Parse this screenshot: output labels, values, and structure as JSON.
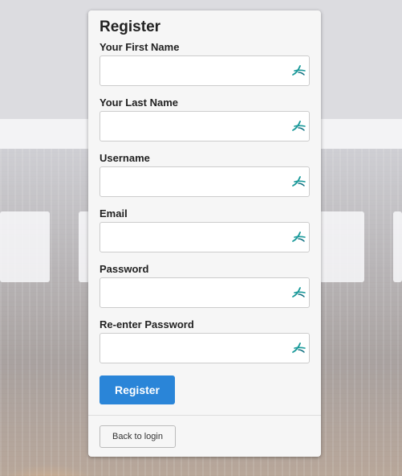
{
  "form": {
    "title": "Register",
    "fields": [
      {
        "label": "Your First Name",
        "value": "",
        "placeholder": "",
        "icon": "autofill-icon"
      },
      {
        "label": "Your Last Name",
        "value": "",
        "placeholder": "",
        "icon": "autofill-icon"
      },
      {
        "label": "Username",
        "value": "",
        "placeholder": "",
        "icon": "autofill-icon"
      },
      {
        "label": "Email",
        "value": "",
        "placeholder": "",
        "icon": "autofill-icon"
      },
      {
        "label": "Password",
        "value": "",
        "placeholder": "",
        "icon": "autofill-icon"
      },
      {
        "label": "Re-enter Password",
        "value": "",
        "placeholder": "",
        "icon": "autofill-icon"
      }
    ],
    "register_label": "Register",
    "back_label": "Back to login"
  },
  "colors": {
    "primary": "#2a85d8",
    "icon": "#1a9a9a"
  }
}
